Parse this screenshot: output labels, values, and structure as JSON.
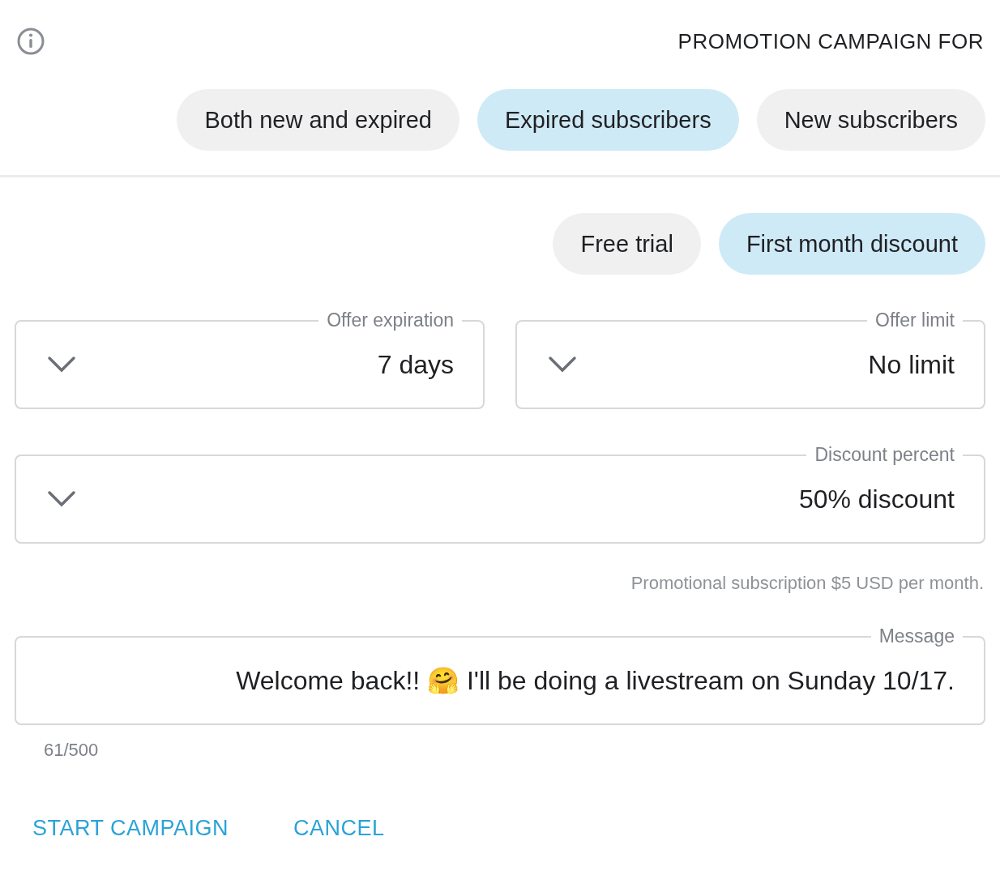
{
  "header": {
    "title": "PROMOTION CAMPAIGN FOR"
  },
  "audience_options": [
    {
      "label": "Both new and expired",
      "selected": false
    },
    {
      "label": "Expired subscribers",
      "selected": true
    },
    {
      "label": "New subscribers",
      "selected": false
    }
  ],
  "offer_types": [
    {
      "label": "Free trial",
      "selected": false
    },
    {
      "label": "First month discount",
      "selected": true
    }
  ],
  "offer_fields": [
    {
      "label": "Offer expiration",
      "value": "7 days"
    },
    {
      "label": "Offer limit",
      "value": "No limit"
    }
  ],
  "discount": {
    "label": "Discount percent",
    "value": "50% discount"
  },
  "hint": "Promotional subscription $5 USD per month.",
  "message": {
    "label": "Message",
    "value": "Welcome back!! 🤗 I'll be doing a livestream on Sunday 10/17."
  },
  "counter": "61/500",
  "buttons": [
    {
      "label": "START CAMPAIGN"
    },
    {
      "label": "CANCEL"
    }
  ]
}
